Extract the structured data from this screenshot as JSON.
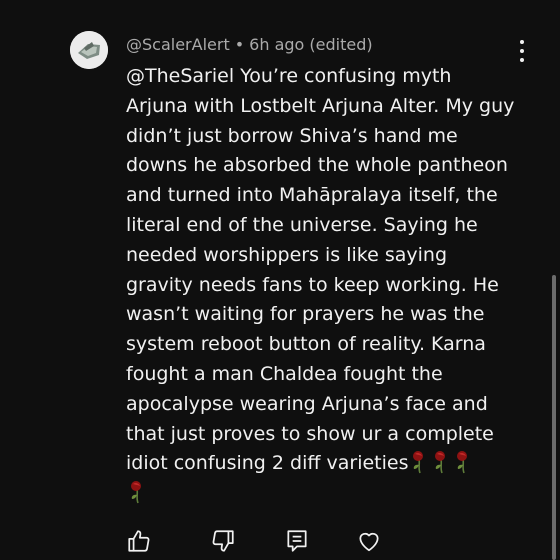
{
  "comment": {
    "author": "@ScalerAlert",
    "separator": "•",
    "timestamp": "6h ago (edited)",
    "lines": [
      "@TheSariel You’re confusing myth",
      "Arjuna with Lostbelt Arjuna Alter. My guy",
      "didn’t just borrow Shiva’s hand me",
      "downs he absorbed the whole pantheon",
      "and turned into Mahāpralaya itself, the",
      "literal end of the universe. Saying he",
      "needed worshippers is like saying",
      "gravity needs fans to keep working. He",
      "wasn’t waiting for prayers he was the",
      "system reboot button of reality. Karna",
      "fought a man Chaldea fought the",
      "apocalypse wearing Arjuna’s face and",
      "that just proves to show ur a complete",
      "idiot confusing 2 diff varieties"
    ]
  },
  "icons": {
    "avatar": "avatar-image",
    "menu": "more-vert-icon",
    "emoji": "wilted-rose-emoji",
    "like": "thumbs-up-icon",
    "dislike": "thumbs-down-icon",
    "reply": "reply-icon",
    "heart": "heart-icon"
  },
  "colors": {
    "background": "#0f0f0f",
    "text": "#f1f1f1",
    "meta": "#aaaaaa"
  }
}
